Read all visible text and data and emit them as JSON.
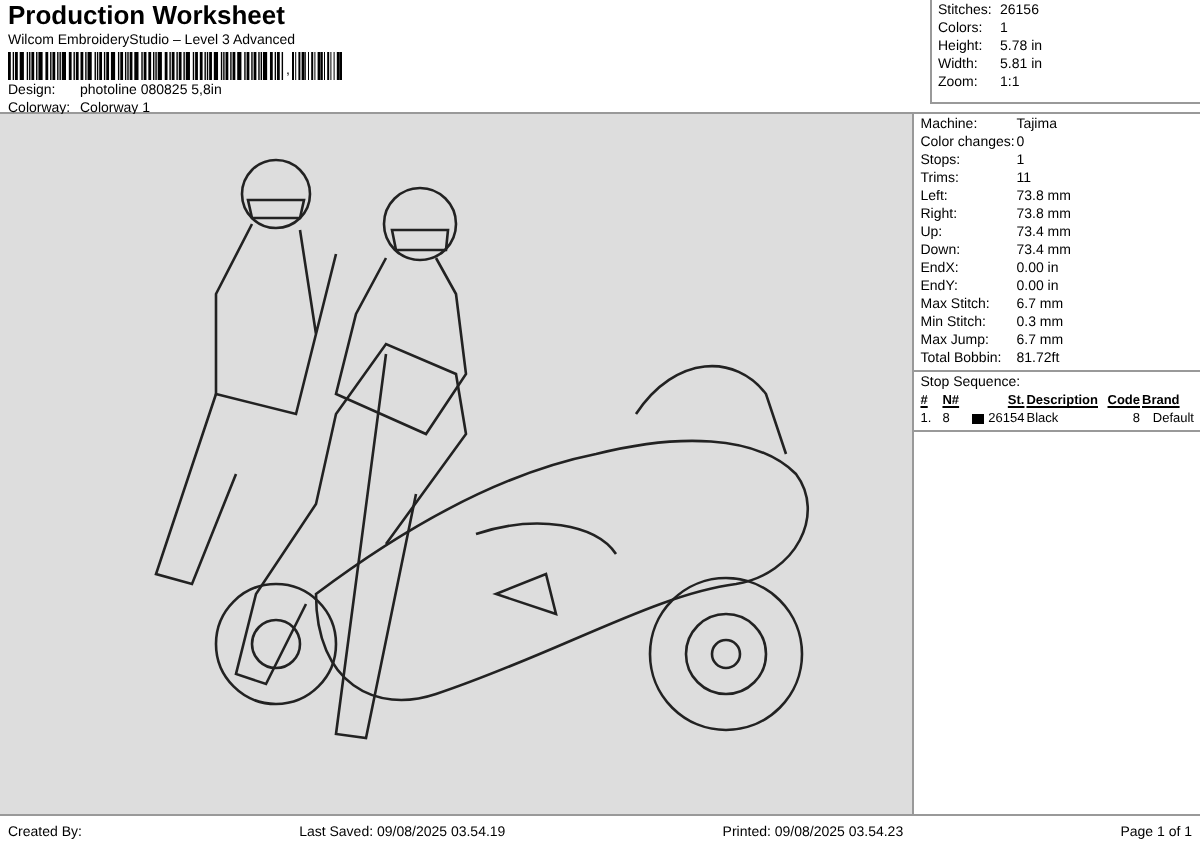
{
  "header": {
    "title": "Production Worksheet",
    "subtitle": "Wilcom EmbroideryStudio – Level 3 Advanced",
    "barcode_suffix": ",",
    "design": {
      "label": "Design:",
      "value": "photoline 080825 5,8in"
    },
    "colorway": {
      "label": "Colorway:",
      "value": "Colorway 1"
    }
  },
  "summary": [
    {
      "label": "Stitches:",
      "value": "26156"
    },
    {
      "label": "Colors:",
      "value": "1"
    },
    {
      "label": "Height:",
      "value": "5.78 in"
    },
    {
      "label": "Width:",
      "value": "5.81 in"
    },
    {
      "label": "Zoom:",
      "value": "1:1"
    }
  ],
  "details": [
    {
      "label": "Machine:",
      "value": "Tajima"
    },
    {
      "label": "Color changes:",
      "value": "0"
    },
    {
      "label": "Stops:",
      "value": "1"
    },
    {
      "label": "Trims:",
      "value": "11"
    },
    {
      "label": "Left:",
      "value": "73.8 mm"
    },
    {
      "label": "Right:",
      "value": "73.8 mm"
    },
    {
      "label": "Up:",
      "value": "73.4 mm"
    },
    {
      "label": "Down:",
      "value": "73.4 mm"
    },
    {
      "label": "EndX:",
      "value": "0.00 in"
    },
    {
      "label": "EndY:",
      "value": "0.00 in"
    },
    {
      "label": "Max Stitch:",
      "value": "6.7 mm"
    },
    {
      "label": "Min Stitch:",
      "value": "0.3 mm"
    },
    {
      "label": "Max Jump:",
      "value": "6.7 mm"
    },
    {
      "label": "Total Bobbin:",
      "value": "81.72ft"
    }
  ],
  "stop_sequence": {
    "title": "Stop Sequence:",
    "columns": [
      "#",
      "N#",
      "St.",
      "Description",
      "Code",
      "Brand"
    ],
    "rows": [
      {
        "index": "1.",
        "number": "8",
        "color": "#000000",
        "stitches": "26154",
        "description": "Black",
        "code": "8",
        "brand": "Default"
      }
    ]
  },
  "footer": {
    "created_by": "Created By:",
    "last_saved": "Last Saved: 09/08/2025 03.54.19",
    "printed": "Printed: 09/08/2025 03.54.23",
    "page": "Page 1 of 1"
  }
}
